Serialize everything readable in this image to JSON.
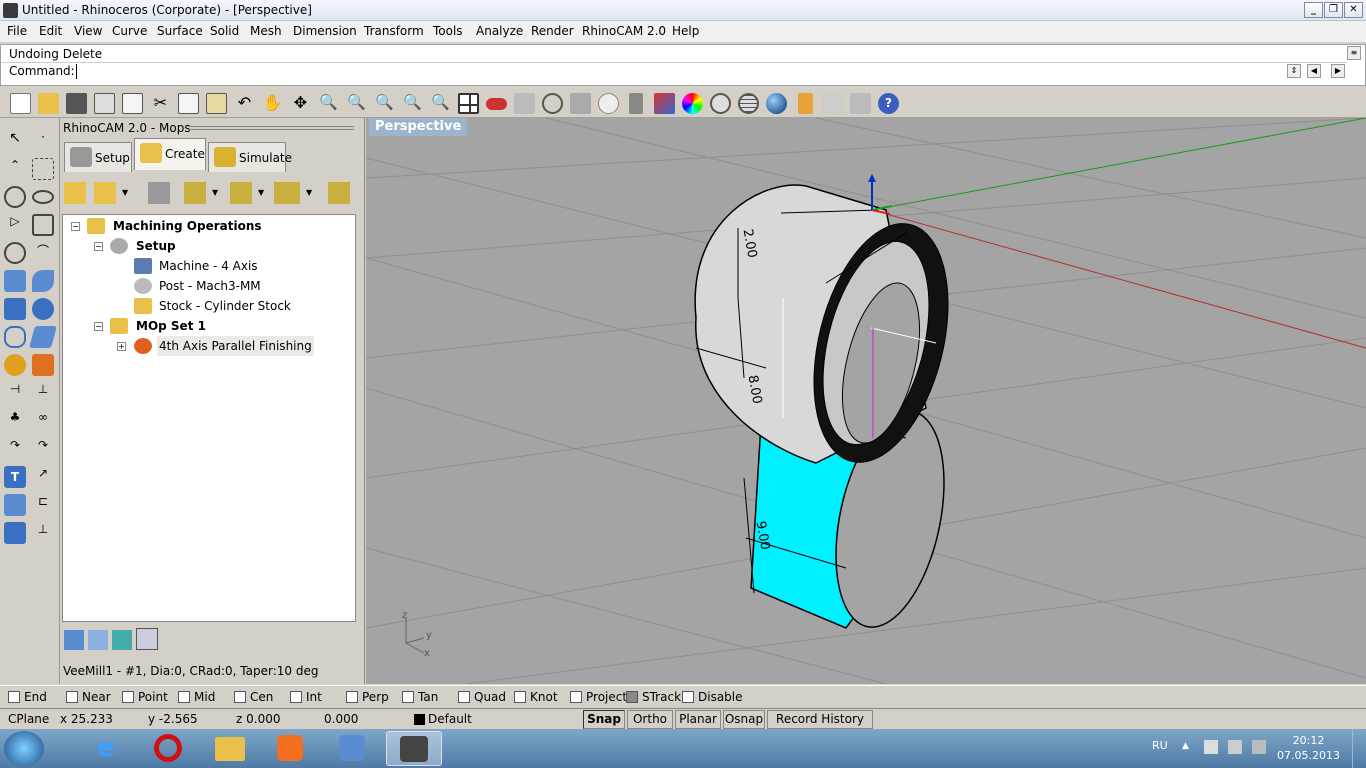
{
  "window": {
    "title": "Untitled - Rhinoceros (Corporate) - [Perspective]"
  },
  "menu": [
    "File",
    "Edit",
    "View",
    "Curve",
    "Surface",
    "Solid",
    "Mesh",
    "Dimension",
    "Transform",
    "Tools",
    "Analyze",
    "Render",
    "RhinoCAM 2.0",
    "Help"
  ],
  "command": {
    "history": "Undoing Delete",
    "prompt": "Command:"
  },
  "panel": {
    "title": "RhinoCAM 2.0 - Mops",
    "tabs": [
      "Setup",
      "Create",
      "Simulate"
    ],
    "tree": {
      "root": "Machining Operations",
      "setup": "Setup",
      "machine": "Machine - 4 Axis",
      "post": "Post - Mach3-MM",
      "stock": "Stock - Cylinder Stock",
      "mopset": "MOp Set 1",
      "op": "4th Axis Parallel Finishing"
    },
    "tool_status": "VeeMill1 - #1, Dia:0, CRad:0, Taper:10 deg"
  },
  "viewport": {
    "title": "Perspective",
    "dims": {
      "d1": "2.00",
      "d2": "8.00",
      "d3": "9.00"
    },
    "axis": {
      "y": "y",
      "z": "z",
      "x": "x"
    }
  },
  "osnap": [
    "End",
    "Near",
    "Point",
    "Mid",
    "Cen",
    "Int",
    "Perp",
    "Tan",
    "Quad",
    "Knot",
    "Project",
    "STrack",
    "Disable"
  ],
  "status": {
    "cplane": "CPlane",
    "x": "x 25.233",
    "y": "y -2.565",
    "z": "z 0.000",
    "d": "0.000",
    "layer": "Default",
    "buttons": [
      "Snap",
      "Ortho",
      "Planar",
      "Osnap",
      "Record History"
    ]
  },
  "taskbar": {
    "lang": "RU",
    "time": "20:12",
    "date": "07.05.2013"
  },
  "colors": {
    "viewport_bg": "#a4a4a4",
    "stock": "#00f0ff",
    "title_blue": "#9cb4cc"
  }
}
